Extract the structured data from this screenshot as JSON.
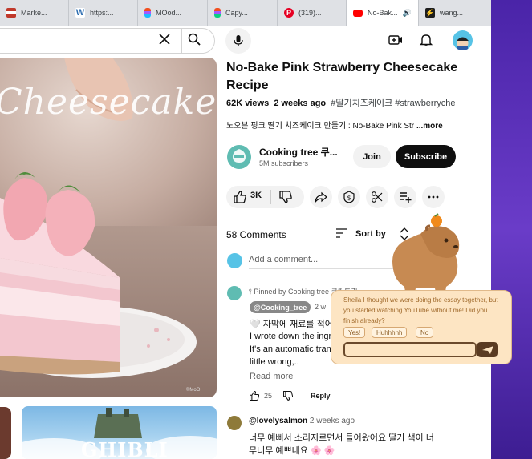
{
  "tabs": [
    {
      "label": "Marke...",
      "favicon": "flag-icon",
      "color": "#c0392b"
    },
    {
      "label": "https:...",
      "favicon": "w-icon",
      "color": "#2b6cb0"
    },
    {
      "label": "MOod...",
      "favicon": "figma-icon",
      "color": "#f24e1e"
    },
    {
      "label": "Capy...",
      "favicon": "figma-icon",
      "color": "#a259ff"
    },
    {
      "label": "(319)...",
      "favicon": "pinterest-icon",
      "color": "#e60023"
    },
    {
      "label": "No-Bak...",
      "favicon": "youtube-icon",
      "color": "#ff0000",
      "active": true
    },
    {
      "label": "wang...",
      "favicon": "pulse-icon",
      "color": "#1d1d1d"
    }
  ],
  "player": {
    "overlay_title": "Cheesecake",
    "watermark": "©MoO"
  },
  "recommendations": {
    "ghibli_text": "GHIBLI"
  },
  "video": {
    "title": "No-Bake Pink Strawberry Cheesecake Recipe",
    "views": "62K views",
    "age": "2 weeks ago",
    "tags": "#딸기치즈케이크 #strawberrychee",
    "description": "노오븐 핑크 딸기 치즈케이크 만들기 : No-Bake Pink Str",
    "more_label": "...more"
  },
  "channel": {
    "name": "Cooking tree 쿠...",
    "subscribers": "5M subscribers",
    "join_label": "Join",
    "subscribe_label": "Subscribe"
  },
  "actions": {
    "like_count": "3K"
  },
  "comments": {
    "count_label": "58 Comments",
    "sort_label": "Sort by",
    "add_placeholder": "Add a comment...",
    "pinned": {
      "pinned_by": "Pinned by Cooking tree 쿠킹트리",
      "handle": "@Cooking_tree",
      "time": "2 w",
      "lines": [
        "🤍 자막에 재료를 적어",
        "I wrote down the ingr",
        "It's an automatic tran",
        "little wrong,.."
      ],
      "read_more": "Read more",
      "likes": "25",
      "reply_label": "Reply"
    },
    "second": {
      "author": "@lovelysalmon",
      "time": "2 weeks ago",
      "lines": [
        "너무 예뻐서 소리지르면서 들어왔어요 딸기 색이 너",
        "무너무 예쁘네요 🌸 🌸"
      ]
    }
  },
  "capybara": {
    "message": "Sheila I thought we were doing the essay together, but you started watching YouTube without me! Did you finish already?",
    "replies": [
      "Yes!",
      "Huhhhhh",
      "No"
    ]
  }
}
